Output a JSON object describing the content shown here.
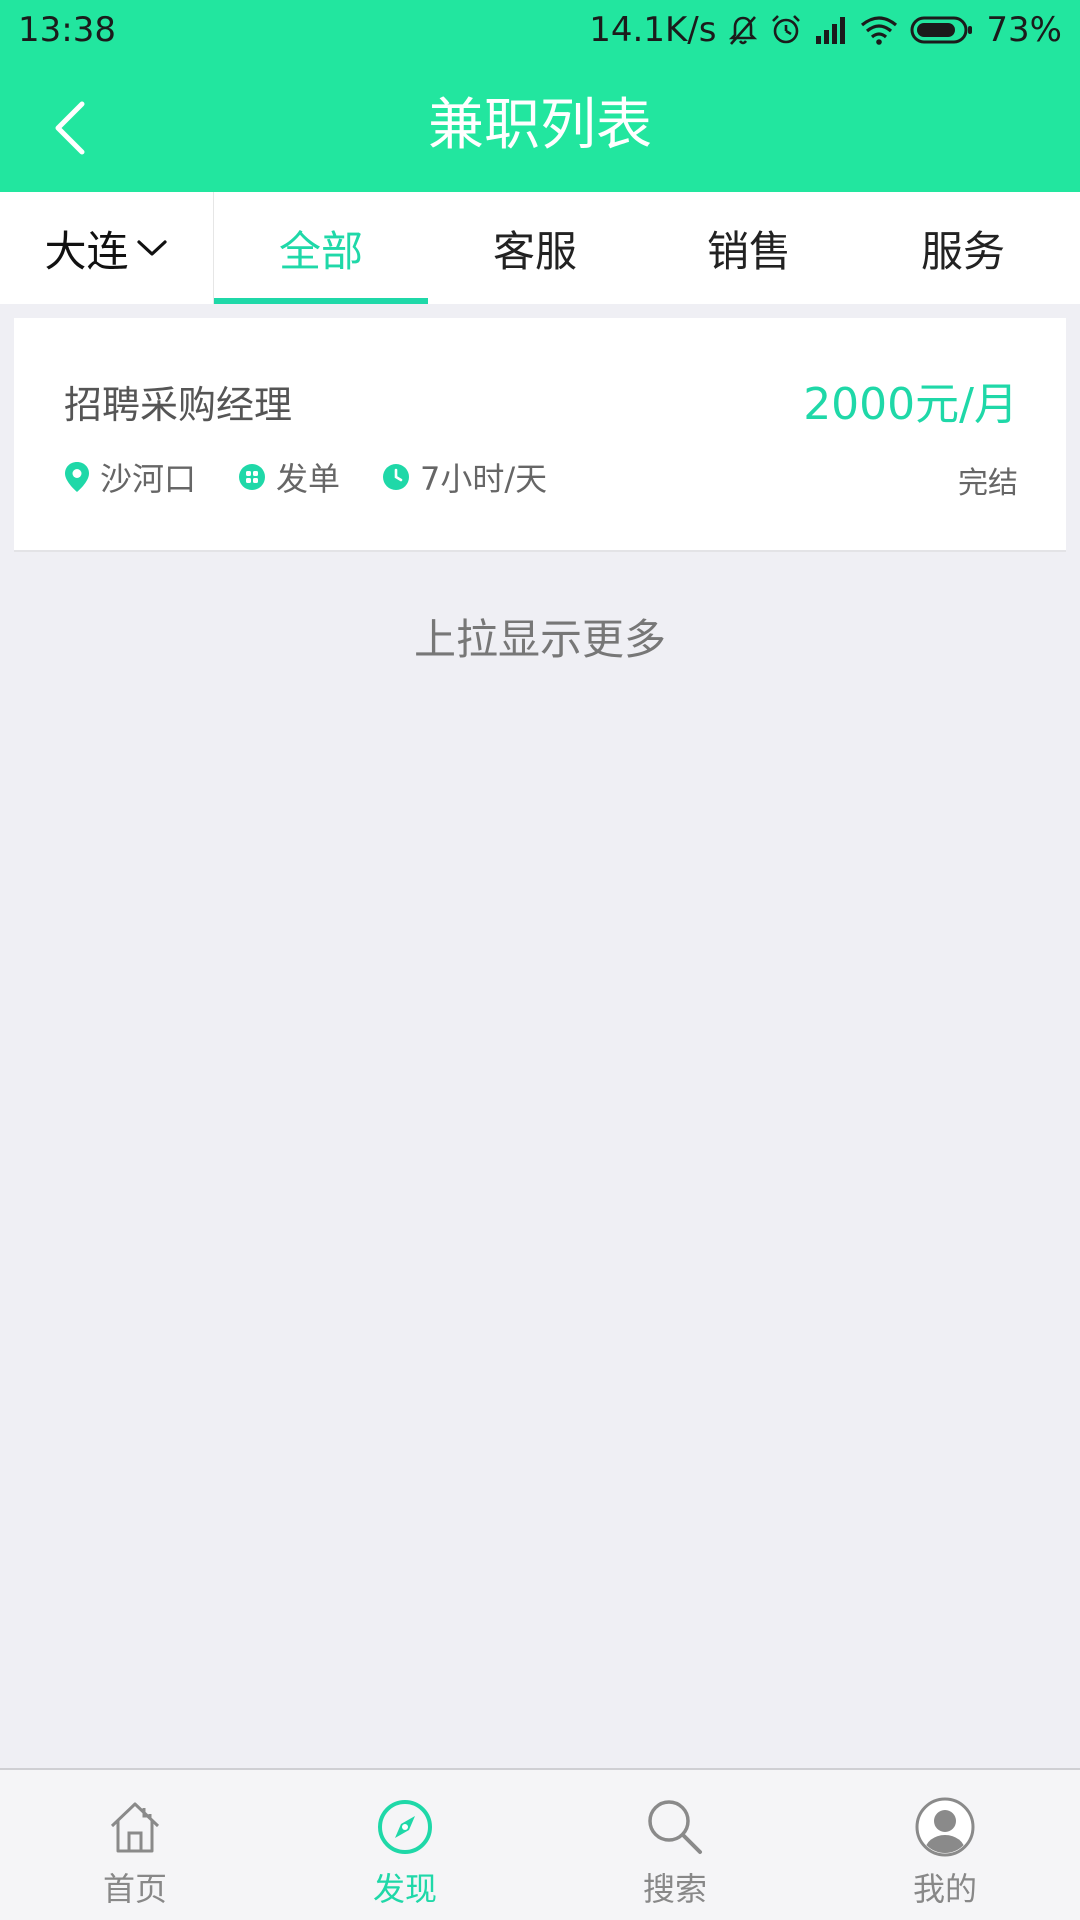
{
  "status_bar": {
    "time": "13:38",
    "network_speed": "14.1K/s",
    "battery": "73%",
    "icons": [
      "mute-icon",
      "alarm-icon",
      "signal-icon",
      "wifi-icon",
      "battery-icon"
    ]
  },
  "header": {
    "title": "兼职列表",
    "back_icon": "back-icon"
  },
  "tabbar": {
    "city": "大连",
    "tabs": [
      {
        "label": "全部",
        "active": true
      },
      {
        "label": "客服",
        "active": false
      },
      {
        "label": "销售",
        "active": false
      },
      {
        "label": "服务",
        "active": false
      }
    ]
  },
  "jobs": [
    {
      "title": "招聘采购经理",
      "salary": "2000元/月",
      "location": "沙河口",
      "settlement": "发单",
      "hours": "7小时/天",
      "status": "完结"
    }
  ],
  "list_footer": "上拉显示更多",
  "bottom_nav": [
    {
      "label": "首页",
      "icon": "home-icon",
      "active": false
    },
    {
      "label": "发现",
      "icon": "compass-icon",
      "active": true
    },
    {
      "label": "搜索",
      "icon": "search-icon",
      "active": false
    },
    {
      "label": "我的",
      "icon": "user-icon",
      "active": false
    }
  ],
  "colors": {
    "brand": "#22e69f",
    "accent": "#1fd8a8",
    "background": "#efeff4"
  }
}
